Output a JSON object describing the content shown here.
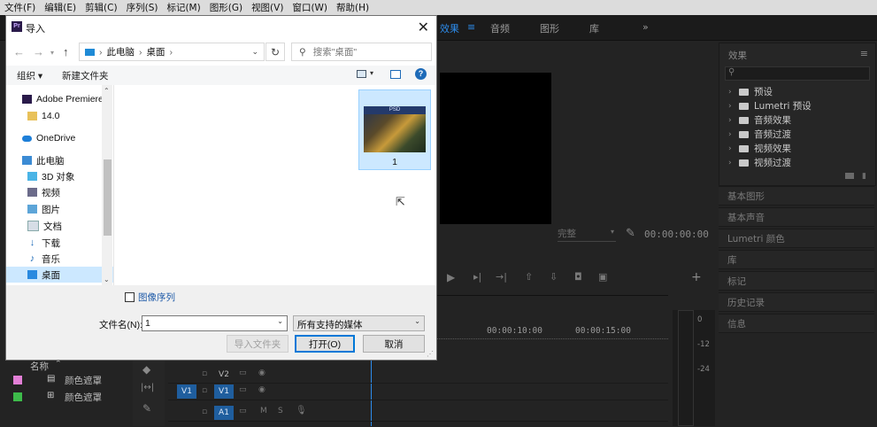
{
  "premiere": {
    "menu": [
      "文件(F)",
      "编辑(E)",
      "剪辑(C)",
      "序列(S)",
      "标记(M)",
      "图形(G)",
      "视图(V)",
      "窗口(W)",
      "帮助(H)"
    ],
    "tabs": [
      {
        "label": "效果",
        "active": true
      },
      {
        "label": "音频",
        "active": false
      },
      {
        "label": "图形",
        "active": false
      },
      {
        "label": "库",
        "active": false
      }
    ],
    "more_tabs": "»",
    "effects": {
      "title": "效果",
      "items": [
        "预设",
        "Lumetri 预设",
        "音频效果",
        "音频过渡",
        "视频效果",
        "视频过渡"
      ]
    },
    "panels": [
      "基本图形",
      "基本声音",
      "Lumetri 颜色",
      "库",
      "标记",
      "历史记录",
      "信息"
    ],
    "monitor": {
      "fit": "完整",
      "timecode": "00:00:00:00"
    },
    "timeline": {
      "timecodes": [
        "00:00:10:00",
        "00:00:15:00"
      ],
      "tracks": [
        {
          "source": "",
          "label": "V2"
        },
        {
          "source": "V1",
          "label": "V1"
        },
        {
          "source": "",
          "label": "A1"
        }
      ],
      "track_icons": [
        "M",
        "S"
      ]
    },
    "meter_ticks": [
      "0",
      "-12",
      "-24"
    ],
    "project": {
      "column_header": "名称",
      "items": [
        {
          "label": "颜色遮罩",
          "swatch": "#e27fd6"
        },
        {
          "label": "颜色遮罩",
          "swatch": "#3dbb4a"
        }
      ]
    }
  },
  "dialog": {
    "title": "导入",
    "address": {
      "root": "此电脑",
      "current": "桌面"
    },
    "search_placeholder": "搜索\"桌面\"",
    "toolbar": {
      "organize": "组织 ▾",
      "new_folder": "新建文件夹"
    },
    "nav": [
      {
        "label": "Adobe Premiere",
        "icon": "premiere-icon"
      },
      {
        "label": "14.0",
        "icon": "folder-icon"
      },
      {
        "label": "OneDrive",
        "icon": "cloud-icon"
      },
      {
        "label": "此电脑",
        "icon": "computer-icon"
      },
      {
        "label": "3D 对象",
        "icon": "cube-icon"
      },
      {
        "label": "视频",
        "icon": "video-icon"
      },
      {
        "label": "图片",
        "icon": "picture-icon"
      },
      {
        "label": "文档",
        "icon": "document-icon"
      },
      {
        "label": "下载",
        "icon": "download-icon"
      },
      {
        "label": "音乐",
        "icon": "music-icon"
      },
      {
        "label": "桌面",
        "icon": "desktop-icon",
        "selected": true
      }
    ],
    "file": {
      "name": "1",
      "thumb_badge": "PSD"
    },
    "image_sequence_label": "图像序列",
    "filename_label": "文件名(N):",
    "filename_value": "1",
    "filetype_value": "所有支持的媒体",
    "buttons": {
      "import_folder": "导入文件夹",
      "open": "打开(O)",
      "cancel": "取消"
    }
  }
}
